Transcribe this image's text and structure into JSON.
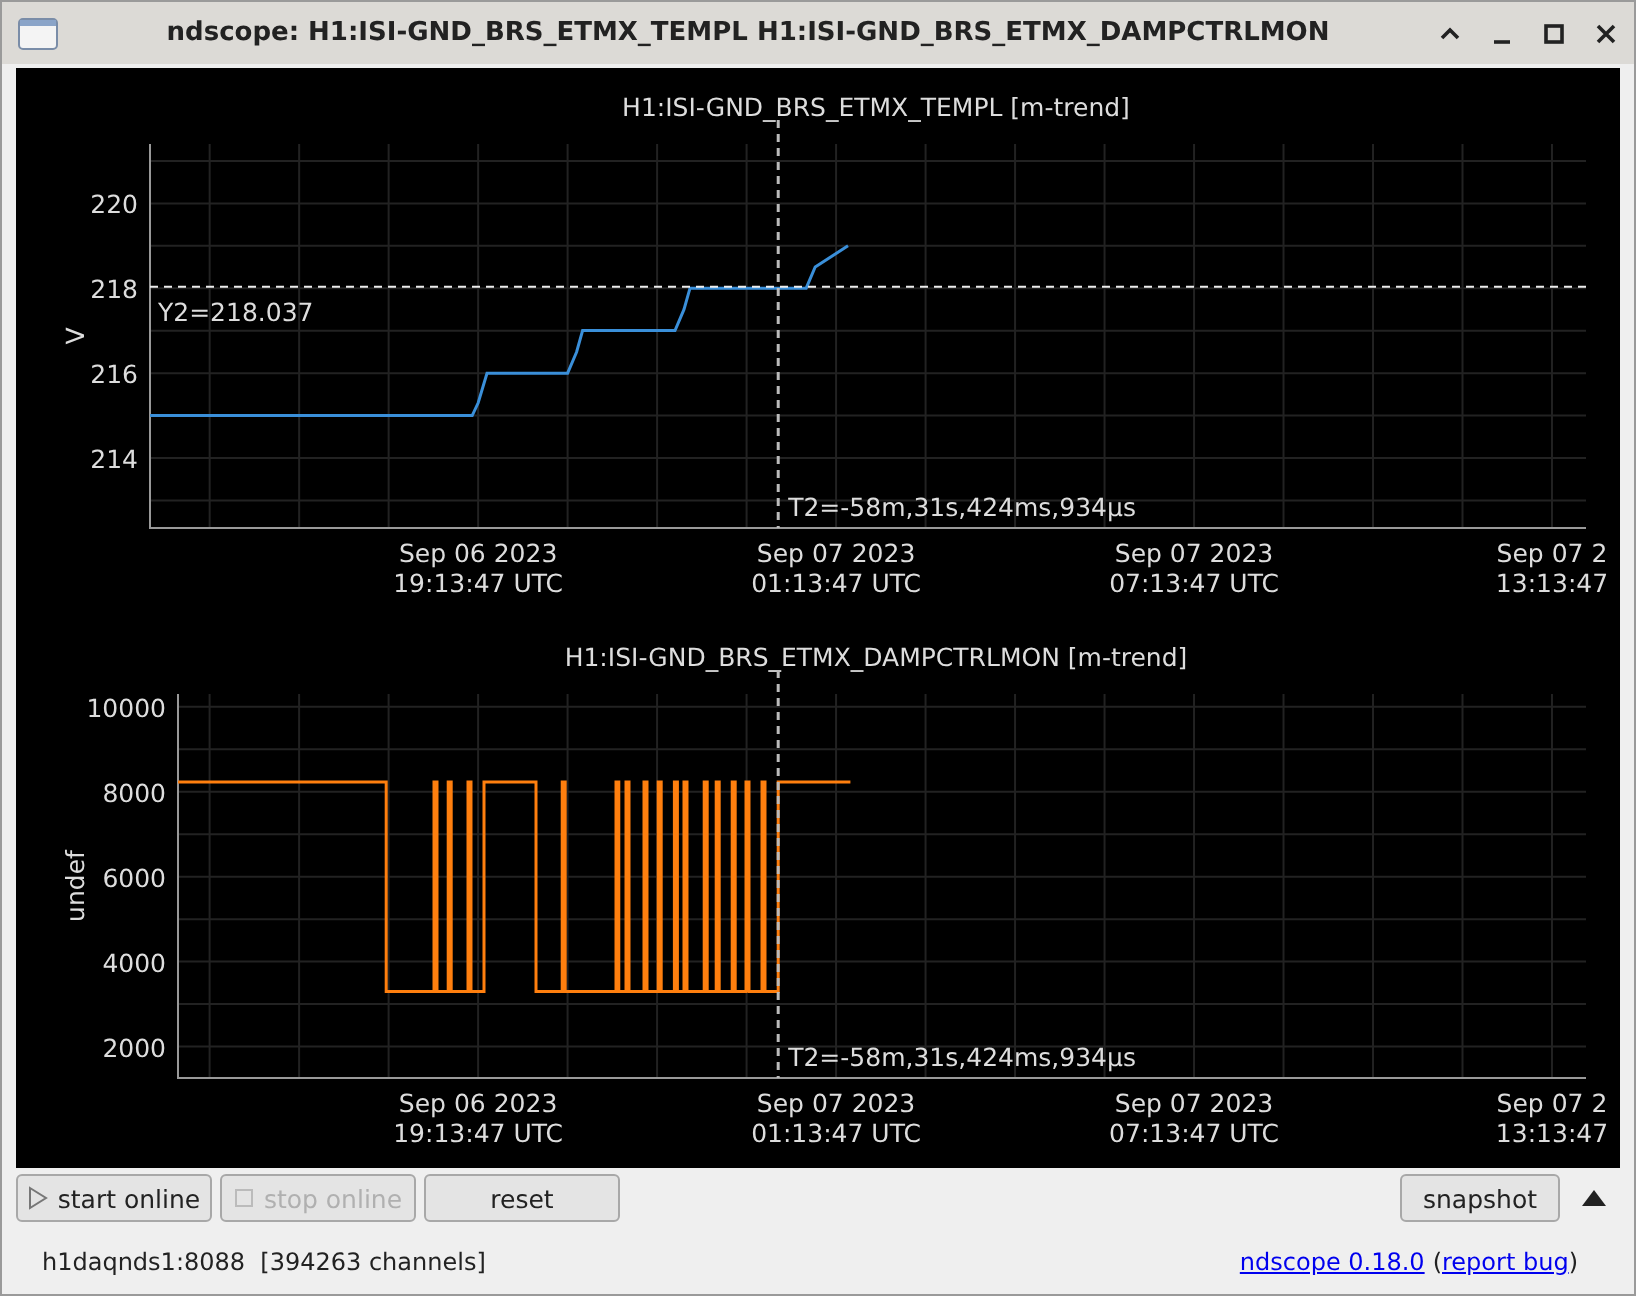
{
  "window": {
    "title": "ndscope: H1:ISI-GND_BRS_ETMX_TEMPL H1:ISI-GND_BRS_ETMX_DAMPCTRLMON"
  },
  "plots": [
    {
      "title": "H1:ISI-GND_BRS_ETMX_TEMPL [m-trend]",
      "ylabel": "V",
      "y_tick_labels": [
        "220",
        "218",
        "216",
        "214"
      ],
      "x_tick_labels": [
        "Sep 06 2023\n19:13:47 UTC",
        "Sep 07 2023\n01:13:47 UTC",
        "Sep 07 2023\n07:13:47 UTC",
        "Sep 07 2\n13:13:47"
      ],
      "cursors": [
        {
          "kind": "horizontal",
          "label": "Y2=218.037"
        },
        {
          "kind": "vertical",
          "label": "T2=-58m,31s,424ms,934µs"
        }
      ]
    },
    {
      "title": "H1:ISI-GND_BRS_ETMX_DAMPCTRLMON [m-trend]",
      "ylabel": "undef",
      "y_tick_labels": [
        "10000",
        "8000",
        "6000",
        "4000",
        "2000"
      ],
      "x_tick_labels": [
        "Sep 06 2023\n19:13:47 UTC",
        "Sep 07 2023\n01:13:47 UTC",
        "Sep 07 2023\n07:13:47 UTC",
        "Sep 07 2\n13:13:47"
      ],
      "cursors": [
        {
          "kind": "vertical",
          "label": "T2=-58m,31s,424ms,934µs"
        }
      ]
    }
  ],
  "buttons": [
    {
      "label": "start online",
      "kind": "start",
      "disabled": false
    },
    {
      "label": "stop online",
      "kind": "stop",
      "disabled": true
    },
    {
      "label": "reset",
      "kind": "plain",
      "disabled": false
    }
  ],
  "snapshot_button": {
    "label": "snapshot",
    "disabled": false
  },
  "status": {
    "server": "h1daqnds1:8088  [394263 channels]",
    "version_link": "ndscope 0.18.0",
    "open": "(",
    "bug_link": "report bug",
    "close": ")"
  }
}
